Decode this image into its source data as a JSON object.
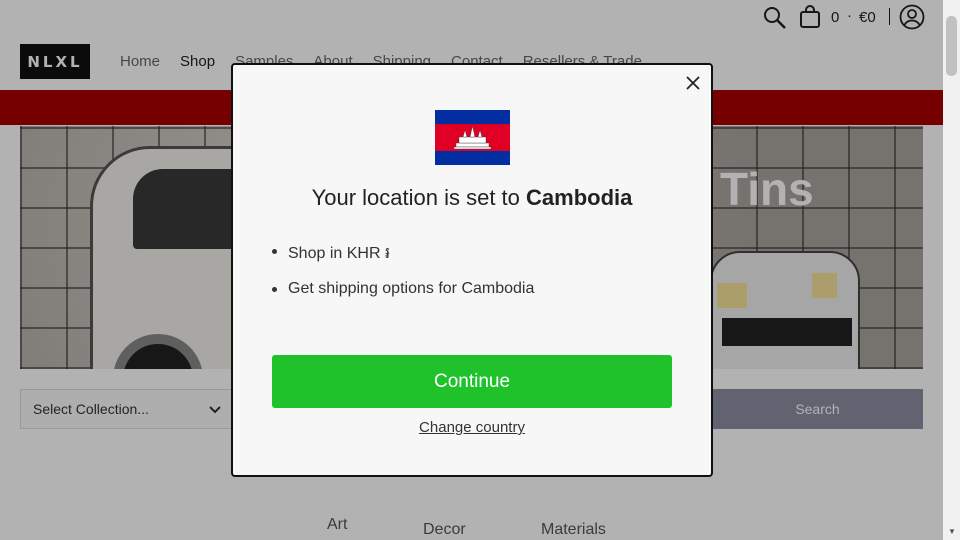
{
  "topbar": {
    "cart_count": "0",
    "cart_separator": "·",
    "cart_total": "€0"
  },
  "logo": {
    "text": "NLXL"
  },
  "nav": {
    "items": [
      "Home",
      "Shop",
      "Samples",
      "About",
      "Shipping",
      "Contact",
      "Resellers & Trade"
    ]
  },
  "hero": {
    "title": "Tins"
  },
  "filters": {
    "select_collection": "Select Collection...",
    "search_label": "Search"
  },
  "categories": [
    "Art",
    "Decor",
    "Materials"
  ],
  "modal": {
    "title_prefix": "Your location is set to",
    "country": "Cambodia",
    "bullets": [
      "Shop in KHR ៛",
      "Get shipping options for Cambodia"
    ],
    "continue_label": "Continue",
    "change_country_label": "Change country"
  },
  "colors": {
    "continue": "#1fc22a",
    "red_bar": "#aa0000",
    "search_btn": "#8b8ea3",
    "flag_blue": "#032ea1",
    "flag_red": "#e00025"
  }
}
